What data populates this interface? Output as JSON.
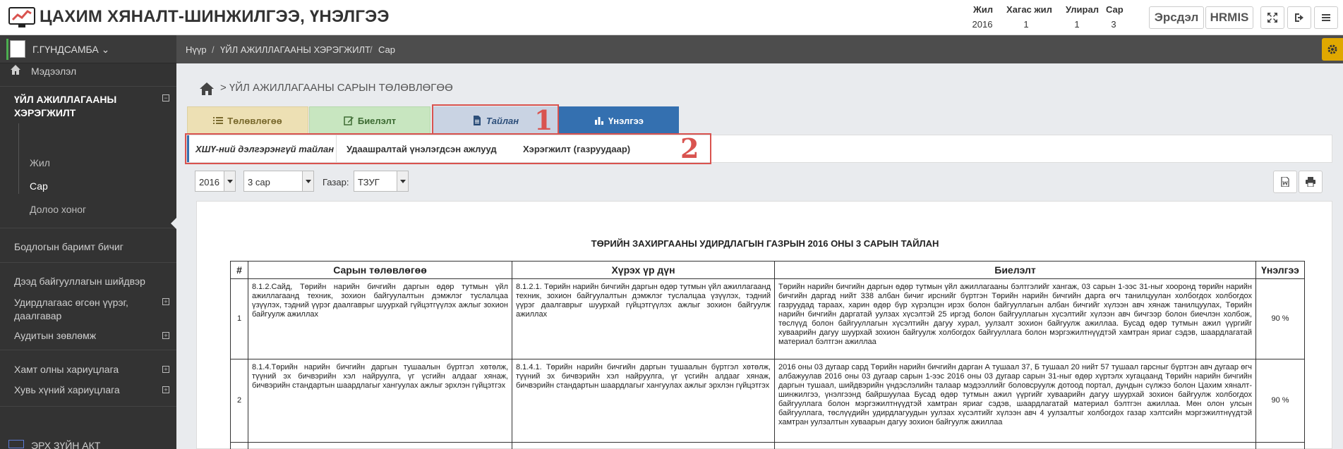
{
  "app": {
    "title": "ЦАХИМ ХЯНАЛТ-ШИНЖИЛГЭЭ, ҮНЭЛГЭЭ"
  },
  "period": {
    "headers": [
      "Жил",
      "Хагас жил",
      "Улирал",
      "Сар"
    ],
    "values": [
      "2016",
      "1",
      "1",
      "3"
    ]
  },
  "header_buttons": {
    "ersdel": "Эрсдэл",
    "hrmis": "HRMIS"
  },
  "user": {
    "name": "Г.ГҮНДСАМБА"
  },
  "sidebar": {
    "items": [
      {
        "label": "Мэдээлэл"
      },
      {
        "label": "ҮЙЛ АЖИЛЛАГААНЫ ХЭРЭГЖИЛТ"
      },
      {
        "label": "Жил"
      },
      {
        "label": "Сар"
      },
      {
        "label": "Долоо хоног"
      },
      {
        "label": "Бодлогын баримт бичиг"
      },
      {
        "label": "Дээд байгууллагын шийдвэр"
      },
      {
        "label": "Удирдлагаас өгсөн үүрэг, даалгавар"
      },
      {
        "label": "Аудитын зөвлөмж"
      },
      {
        "label": "Хамт олны хариуцлага"
      },
      {
        "label": "Хувь хүний хариуцлага"
      },
      {
        "label": "ЭРХ ЗҮЙН АКТ"
      }
    ]
  },
  "breadcrumb": [
    "Нүүр",
    "ҮЙЛ АЖИЛЛАГААНЫ ХЭРЭГЖИЛТ",
    "Сар"
  ],
  "page": {
    "heading": "> ҮЙЛ АЖИЛЛАГААНЫ САРЫН ТӨЛӨВЛӨГӨӨ"
  },
  "tabs": [
    {
      "label": "Төлөвлөгөө",
      "color": "#ede0b4"
    },
    {
      "label": "Биелэлт",
      "color": "#c8e6c0"
    },
    {
      "label": "Тайлан",
      "color": "#c9d3e3"
    },
    {
      "label": "Үнэлгээ",
      "color": "#3470b0"
    }
  ],
  "subtabs": [
    "ХШҮ-ний дэлгэрэнгүй тайлан",
    "Удаашралтай үнэлэгдсэн ажлууд",
    "Хэрэгжилт (газруудаар)"
  ],
  "annotations": {
    "box1": "1",
    "box2": "2"
  },
  "filters": {
    "year": "2016",
    "month": "3 сар",
    "gazar_label": "Газар:",
    "gazar": "ТЗУГ"
  },
  "report": {
    "title": "ТӨРИЙН ЗАХИРГААНЫ УДИРДЛАГЫН ГАЗРЫН 2016 ОНЫ 3 САРЫН ТАЙЛАН",
    "columns": [
      "#",
      "Сарын төлөвлөгөө",
      "Хүрэх үр дүн",
      "Биелэлт",
      "Үнэлгээ"
    ],
    "rows": [
      {
        "num": "1",
        "plan": "8.1.2.Сайд, Төрийн нарийн бичгийн даргын өдөр тутмын үйл ажиллагаанд техник, зохион байгуулалтын дэмжлэг туслалцаа үзүүлэх, тэдний үүрэг даалгаврыг шуурхай гүйцэтгүүлэх ажлыг зохион байгуулж ажиллах",
        "result": "8.1.2.1. Төрийн нарийн бичгийн даргын өдөр тутмын үйл ажиллагаанд техник, зохион байгуулалтын дэмжлэг туслалцаа үзүүлэх, тэдний үүрэг даалгаврыг шуурхай гүйцэтгүүлэх ажлыг зохион байгуулж ажиллах",
        "done": "Төрийн нарийн бичгийн даргын өдөр тутмын үйл ажиллагааны бэлтгэлийг хангаж, 03 сарын 1-ээс 31-ныг хооронд төрийн нарийн бичгийн даргад нийт 338 албан бичиг ирснийг бүртгэн Төрийн нарийн бичгийн дарга өгч танилцуулан холбогдох холбогдох газруудад тараах, харин өдөр бүр хүрэлцэн ирэх болон байгууллагын албан бичгийг хүлээн авч хянаж танилцуулах, Төрийн нарийн бичгийн даргатай уулзах хүсэлтэй 25 иргэд болон байгууллагын хүсэлтийг хүлээн авч бичгээр болон биечлэн холбож, төслүүд болон байгууллагын хүсэлтийн дагуу хурал, уулзалт зохион байгуулж ажиллаа. Бусад өдөр тутмын ажил үүргийг хуваарийн дагуу шуурхай зохион байгуулж холбогдох байгууллага болон мэргэжилтнүүдтэй хамтран яриаг сэдэв, шаардлагатай материал бэлтгэн ажиллаа",
        "score": "90 %"
      },
      {
        "num": "2",
        "plan": "8.1.4.Төрийн нарийн бичгийн даргын тушаалын бүртгэл хөтөлж, түүний эх бичвэрийн хэл найруулга, үг үсгийн алдааг хянаж, бичвэрийн стандартын шаардлагыг хангуулах ажлыг эрхлэн гүйцэтгэх",
        "result": "8.1.4.1. Төрийн нарийн бичгийн даргын тушаалын бүртгэл хөтөлж, түүний эх бичвэрийн хэл найруулга, үг үсгийн алдааг хянаж, бичвэрийн стандартын шаардлагыг хангуулах ажлыг эрхлэн гүйцэтгэх",
        "done": "2016 оны 03 дугаар сард Төрийн нарийн бичгийн дарган А тушаал 37, Б тушаал 20 нийт 57 тушаал гарсныг бүртгэн авч дугаар өгч албажуулав 2016 оны 03 дугаар сарын 1-ээс 2016 оны 03 дугаар сарын 31-ныг өдөр хүртэлх хугацаанд Төрийн нарийн бичгийн даргын тушаал, шийдвэрийн үндэслэлийн талаар мэдээллийг боловсруулж дотоод портал, дундын сүлжээ болон Цахим хяналт-шинжилгээ, үнэлгээнд байршуулаа Бусад өдөр тутмын ажил үүргийг хуваарийн дагуу шуурхай зохион байгуулж холбогдох байгууллага болон мэргэжилтнүүдтэй хамтран яриаг сэдэв, шаардлагатай материал бэлтгэн ажиллаа. Мөн олон улсын байгууллага, төслүүдийн удирдлагуудын уулзах хүсэлтийг хүлээн авч 4 уулзалтыг холбогдох газар хэлтсийн мэргэжилтнүүдтэй хамтран уулзалтын хуваарын дагуу зохион байгуулж ажиллаа",
        "score": "90 %"
      }
    ]
  }
}
